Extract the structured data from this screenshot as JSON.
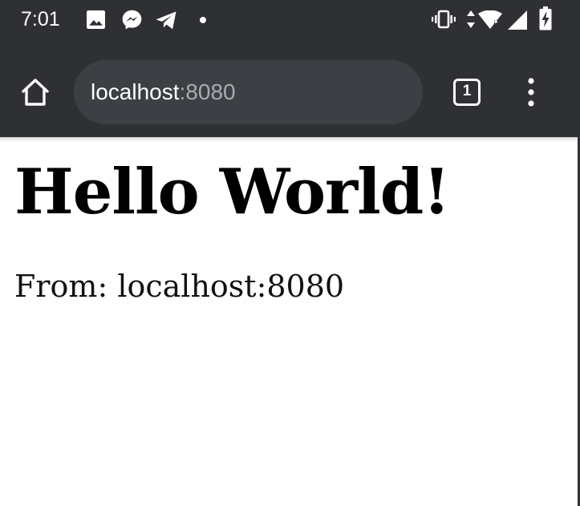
{
  "status_bar": {
    "time": "7:01",
    "left_icons": [
      "image-icon",
      "messenger-icon",
      "telegram-icon",
      "dot-icon"
    ],
    "right_icons": [
      "vibrate-icon",
      "data-arrows-icon",
      "wifi-icon",
      "cell-signal-icon",
      "battery-charging-icon"
    ],
    "wifi_badge": "4"
  },
  "toolbar": {
    "home_icon": "home-icon",
    "url_host": "localhost",
    "url_port": ":8080",
    "tab_count": "1",
    "menu_icon": "overflow-menu-icon"
  },
  "page": {
    "heading": "Hello World!",
    "from_text": "From: localhost:8080"
  },
  "colors": {
    "chrome_bg": "#2f3033",
    "omnibox_bg": "#3c3f43",
    "url_host": "#ffffff",
    "url_port": "#a8abb0",
    "page_bg": "#ffffff"
  }
}
